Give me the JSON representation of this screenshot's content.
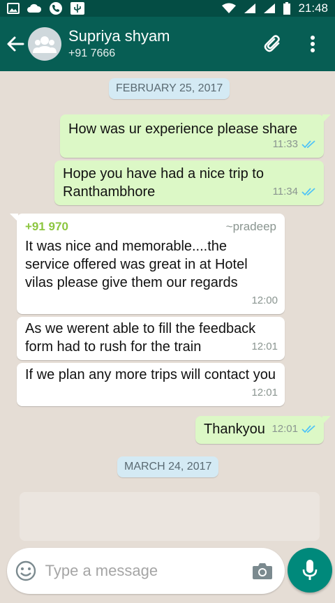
{
  "status_bar": {
    "time": "21:48",
    "icons": [
      "image-icon",
      "cloud-icon",
      "phone-icon",
      "usb-icon",
      "wifi-icon",
      "signal-icon",
      "signal-icon",
      "battery-icon"
    ]
  },
  "header": {
    "contact_name": "Supriya shyam",
    "contact_sub": "+91 7666",
    "icons": [
      "back-arrow-icon",
      "group-avatar-icon",
      "paperclip-icon",
      "more-vertical-icon"
    ]
  },
  "chat": {
    "dates": [
      "FEBRUARY 25, 2017",
      "MARCH 24, 2017"
    ],
    "messages": [
      {
        "direction": "out",
        "text": "How was ur experience please share",
        "time": "11:33",
        "status": "read"
      },
      {
        "direction": "out",
        "text": "Hope you have had a nice trip to Ranthambhore",
        "time": "11:34",
        "status": "read"
      },
      {
        "direction": "in",
        "sender_number": "+91 970",
        "sender_alias": "~pradeep",
        "text": "It was nice and memorable....the service offered was great in at Hotel vilas please give them our regards",
        "time": "12:00"
      },
      {
        "direction": "in",
        "text": "As we werent able to fill the feedback form had to rush for the train",
        "time": "12:01"
      },
      {
        "direction": "in",
        "text": "If we plan any more trips will contact you",
        "time": "12:01"
      },
      {
        "direction": "out",
        "text": "Thankyou",
        "time": "12:01",
        "status": "read"
      }
    ]
  },
  "composer": {
    "placeholder": "Type a message",
    "value": ""
  },
  "colors": {
    "status_bar": "#044d44",
    "app_bar": "#075e54",
    "outgoing_bubble": "#dcf8c6",
    "incoming_bubble": "#ffffff",
    "read_ticks": "#4fc3f7",
    "sender_number": "#8cc63f",
    "date_pill": "#d4eaf4",
    "mic_button": "#00897b"
  }
}
